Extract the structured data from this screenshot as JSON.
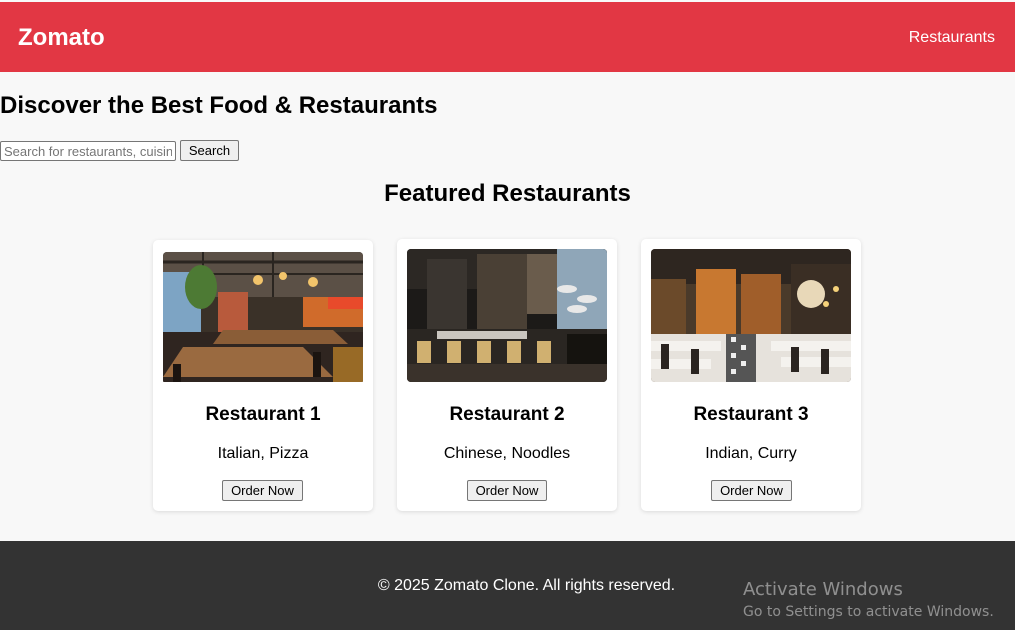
{
  "header": {
    "brand": "Zomato",
    "nav_link": "Restaurants",
    "color": "#e23744"
  },
  "hero": {
    "title": "Discover the Best Food & Restaurants",
    "search_placeholder": "Search for restaurants, cuisines...",
    "search_button": "Search"
  },
  "featured": {
    "title": "Featured Restaurants",
    "restaurants": [
      {
        "name": "Restaurant 1",
        "cuisine": "Italian, Pizza",
        "button": "Order Now",
        "image_icon": "restaurant-interior-photo"
      },
      {
        "name": "Restaurant 2",
        "cuisine": "Chinese, Noodles",
        "button": "Order Now",
        "image_icon": "restaurant-interior-photo"
      },
      {
        "name": "Restaurant 3",
        "cuisine": "Indian, Curry",
        "button": "Order Now",
        "image_icon": "restaurant-interior-photo"
      }
    ]
  },
  "footer": {
    "text": "© 2025 Zomato Clone. All rights reserved.",
    "color": "#333333"
  },
  "watermark": {
    "title": "Activate Windows",
    "subtitle": "Go to Settings to activate Windows."
  }
}
